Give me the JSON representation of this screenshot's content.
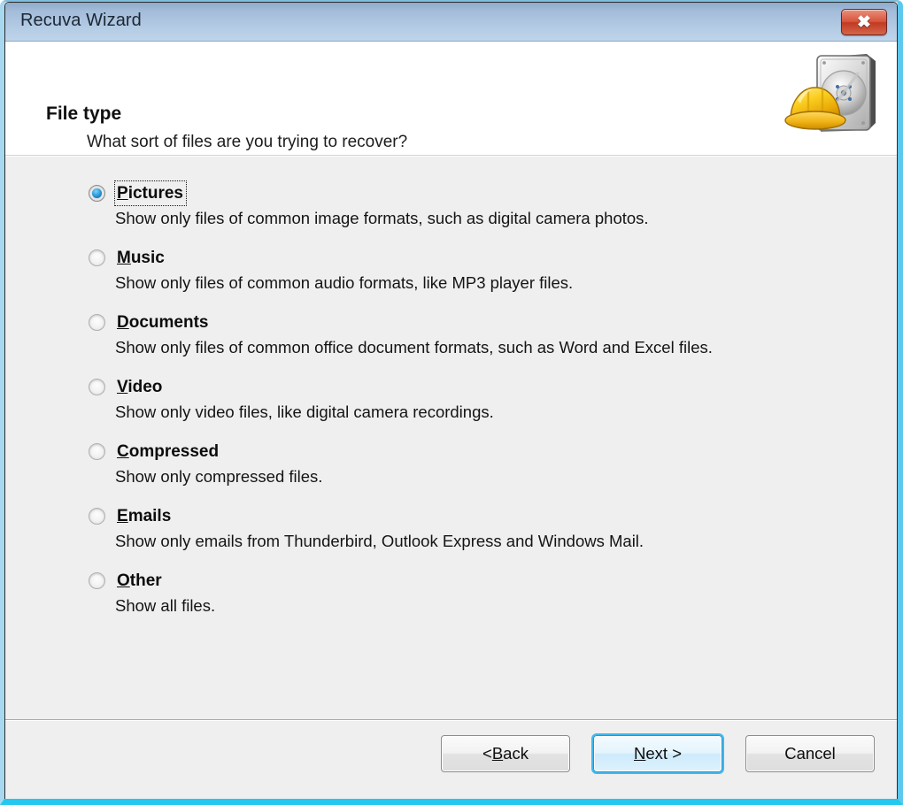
{
  "window": {
    "title": "Recuva Wizard",
    "close_icon": "close-icon",
    "close_label": "✖"
  },
  "header": {
    "title": "File type",
    "subtitle": "What sort of files are you trying to recover?",
    "icon": "recuva-harddrive-hardhat-icon"
  },
  "options": [
    {
      "id": "pictures",
      "accel": "P",
      "rest": "ictures",
      "label": "Pictures",
      "description": "Show only files of common image formats, such as digital camera photos.",
      "selected": true,
      "focused": true
    },
    {
      "id": "music",
      "accel": "M",
      "rest": "usic",
      "label": "Music",
      "description": "Show only files of common audio formats, like MP3 player files.",
      "selected": false,
      "focused": false
    },
    {
      "id": "documents",
      "accel": "D",
      "rest": "ocuments",
      "label": "Documents",
      "description": "Show only files of common office document formats, such as Word and Excel files.",
      "selected": false,
      "focused": false
    },
    {
      "id": "video",
      "accel": "V",
      "rest": "ideo",
      "label": "Video",
      "description": "Show only video files, like digital camera recordings.",
      "selected": false,
      "focused": false
    },
    {
      "id": "compressed",
      "accel": "C",
      "rest": "ompressed",
      "label": "Compressed",
      "description": "Show only compressed files.",
      "selected": false,
      "focused": false
    },
    {
      "id": "emails",
      "accel": "E",
      "rest": "mails",
      "label": "Emails",
      "description": "Show only emails from Thunderbird, Outlook Express and Windows Mail.",
      "selected": false,
      "focused": false
    },
    {
      "id": "other",
      "accel": "O",
      "rest": "ther",
      "label": "Other",
      "description": "Show all files.",
      "selected": false,
      "focused": false
    }
  ],
  "footer": {
    "back": {
      "pre": "< ",
      "accel": "B",
      "post": "ack"
    },
    "next": {
      "pre": "",
      "accel": "N",
      "post": "ext >"
    },
    "cancel": {
      "pre": "",
      "accel": "",
      "post": "Cancel"
    }
  },
  "colors": {
    "titlebar_top": "#8fabcc",
    "titlebar_bottom": "#bed4ea",
    "window_glow": "#22c8ef",
    "default_button_border": "#41b8ef",
    "close_button": "#c13a22",
    "panel_bg": "#efefef"
  }
}
